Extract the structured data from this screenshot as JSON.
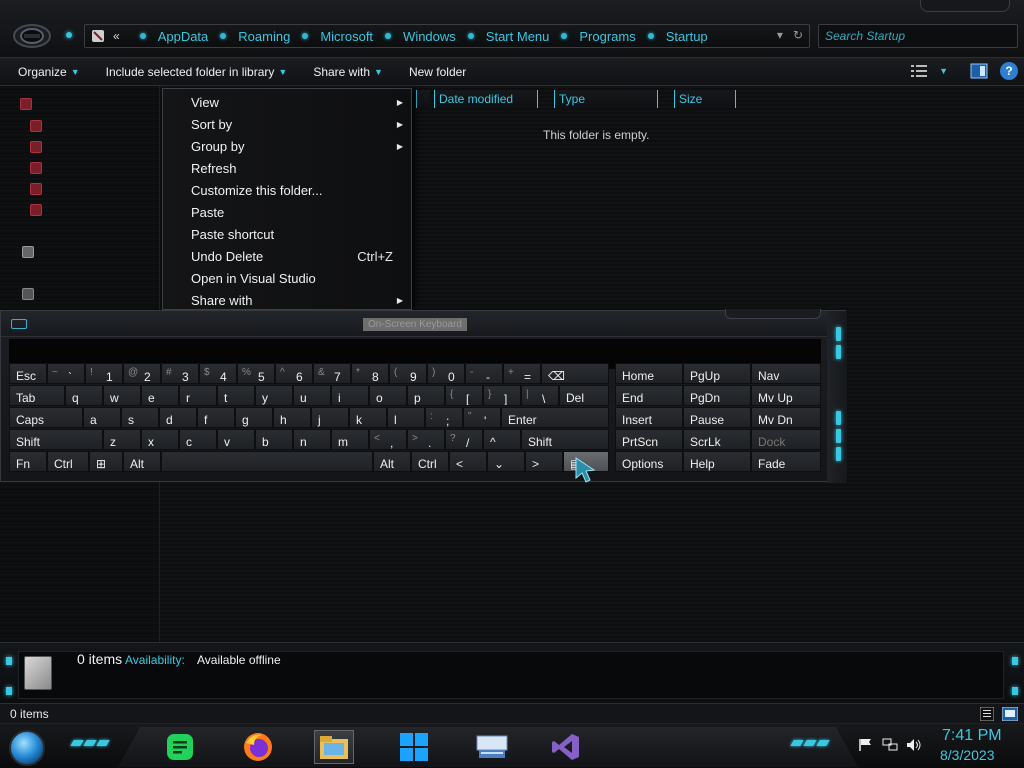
{
  "address": {
    "back_glyph": "«",
    "crumbs": [
      "AppData",
      "Roaming",
      "Microsoft",
      "Windows",
      "Start Menu",
      "Programs",
      "Startup"
    ],
    "search_placeholder": "Search Startup"
  },
  "toolbar": {
    "organize": "Organize",
    "include": "Include selected folder in library",
    "share": "Share with",
    "new_folder": "New folder"
  },
  "columns": [
    "Date modified",
    "Type",
    "Size"
  ],
  "content": {
    "empty_message": "This folder is empty."
  },
  "context_menu": [
    {
      "label": "View",
      "submenu": true
    },
    {
      "label": "Sort by",
      "submenu": true
    },
    {
      "label": "Group by",
      "submenu": true
    },
    {
      "label": "Refresh"
    },
    {
      "label": "Customize this folder..."
    },
    {
      "label": "Paste"
    },
    {
      "label": "Paste shortcut"
    },
    {
      "label": "Undo Delete",
      "shortcut": "Ctrl+Z"
    },
    {
      "label": "Open in Visual Studio"
    },
    {
      "label": "Share with",
      "submenu": true
    }
  ],
  "keyboard": {
    "title": "On-Screen Keyboard",
    "row1": [
      {
        "main": "Esc"
      },
      {
        "sub": "~",
        "main": "`"
      },
      {
        "sub": "!",
        "main": "1"
      },
      {
        "sub": "@",
        "main": "2"
      },
      {
        "sub": "#",
        "main": "3"
      },
      {
        "sub": "$",
        "main": "4"
      },
      {
        "sub": "%",
        "main": "5"
      },
      {
        "sub": "^",
        "main": "6"
      },
      {
        "sub": "&",
        "main": "7"
      },
      {
        "sub": "*",
        "main": "8"
      },
      {
        "sub": "(",
        "main": "9"
      },
      {
        "sub": ")",
        "main": "0"
      },
      {
        "sub": "-",
        "main": "-"
      },
      {
        "sub": "+",
        "main": "="
      },
      {
        "main": "⌫"
      }
    ],
    "row2": [
      "Tab",
      "q",
      "w",
      "e",
      "r",
      "t",
      "y",
      "u",
      "i",
      "o",
      "p",
      "[",
      "]",
      "\\",
      "Del"
    ],
    "row2_subs": {
      "[": "{",
      "]": "}",
      "\\": "|"
    },
    "row3": [
      "Caps",
      "a",
      "s",
      "d",
      "f",
      "g",
      "h",
      "j",
      "k",
      "l",
      ";",
      "'",
      "Enter"
    ],
    "row3_subs": {
      ";": ":",
      "'": "\""
    },
    "row4": [
      "Shift",
      "z",
      "x",
      "c",
      "v",
      "b",
      "n",
      "m",
      ",",
      ".",
      "/",
      "^",
      "Shift"
    ],
    "row4_subs": {
      ",": "<",
      ".": ">",
      "/": "?"
    },
    "row5": [
      "Fn",
      "Ctrl",
      "⊞",
      "Alt",
      "",
      "Alt",
      "Ctrl",
      "<",
      "⌄",
      ">",
      "▤"
    ],
    "nav_keys": [
      [
        "Home",
        "PgUp",
        "Nav"
      ],
      [
        "End",
        "PgDn",
        "Mv Up"
      ],
      [
        "Insert",
        "Pause",
        "Mv Dn"
      ],
      [
        "PrtScn",
        "ScrLk",
        "Dock"
      ],
      [
        "Options",
        "Help",
        "Fade"
      ]
    ]
  },
  "details": {
    "count": "0 items",
    "availability_label": "Availability:",
    "availability_value": "Available offline"
  },
  "status": {
    "text": "0 items"
  },
  "clock": {
    "time": "7:41 PM",
    "date": "8/3/2023"
  },
  "accent": "#3cc8e0"
}
